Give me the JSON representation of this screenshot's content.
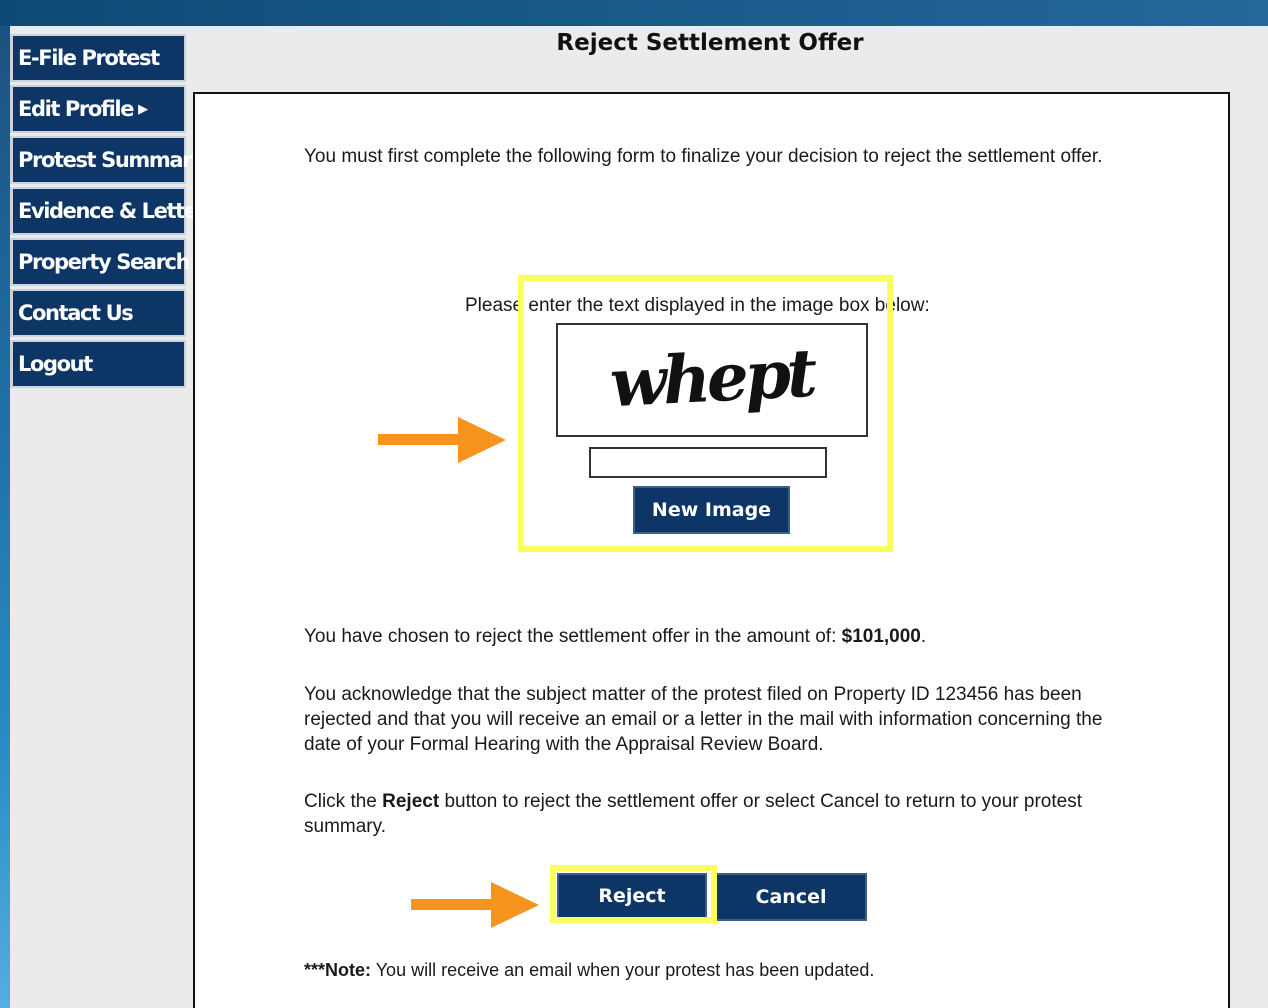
{
  "nav": {
    "items": [
      {
        "label": "E-File Protest"
      },
      {
        "label": "Edit Profile"
      },
      {
        "label": "Protest Summary"
      },
      {
        "label": "Evidence & Letters"
      },
      {
        "label": "Property Search"
      },
      {
        "label": "Contact Us"
      },
      {
        "label": "Logout"
      }
    ]
  },
  "page": {
    "title": "Reject Settlement Offer"
  },
  "form": {
    "intro": "You must first complete the following form to finalize your decision to reject the settlement offer.",
    "captcha_prompt": "Please enter the text displayed in the image box below:",
    "captcha_text": "whept",
    "captcha_input_value": "",
    "new_image_label": "New Image",
    "amount_prefix": "You have chosen to reject the settlement offer in the amount of:",
    "amount": "$101,000",
    "amount_suffix": ".",
    "acknowledgement": "You acknowledge that the subject matter of the protest filed on Property ID 123456 has been rejected and that you will receive an email or a letter in the mail with information concerning the date of your Formal Hearing with the Appraisal Review Board.",
    "instr_prefix": "Click the",
    "instr_bold": "Reject",
    "instr_suffix": "button to reject the settlement offer or select Cancel to return to your protest summary.",
    "reject_label": "Reject",
    "cancel_label": "Cancel",
    "note_bold": "***Note:",
    "note_text": "You will receive an email when your protest has been updated."
  },
  "annotations": {
    "highlight_color": "#fbff5e",
    "arrow_color": "#f7941d"
  }
}
